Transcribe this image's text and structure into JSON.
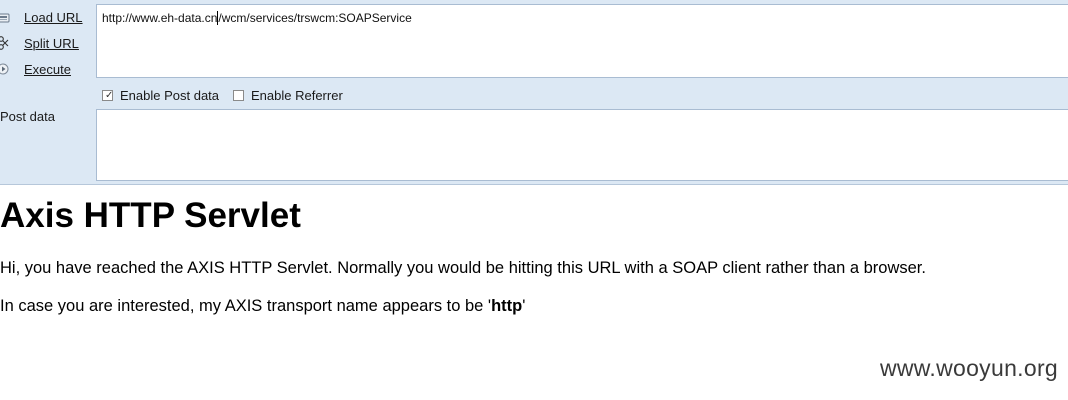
{
  "toolbar": {
    "load_url": "Load URL",
    "split_url": "Split URL",
    "execute": "Execute"
  },
  "url_field": {
    "before_caret": "http://www.eh-data.cn",
    "after_caret": "/wcm/services/trswcm:SOAPService"
  },
  "options": {
    "enable_post_data": {
      "label": "Enable Post data",
      "checked": true
    },
    "enable_referrer": {
      "label": "Enable Referrer",
      "checked": false
    }
  },
  "post_data": {
    "label": "Post data",
    "value": ""
  },
  "page": {
    "heading": "Axis HTTP Servlet",
    "paragraph1": "Hi, you have reached the AXIS HTTP Servlet. Normally you would be hitting this URL with a SOAP client rather than a browser.",
    "paragraph2_prefix": "In case you are interested, my AXIS transport name appears to be '",
    "paragraph2_bold": "http",
    "paragraph2_suffix": "'"
  },
  "watermark": "www.wooyun.org"
}
